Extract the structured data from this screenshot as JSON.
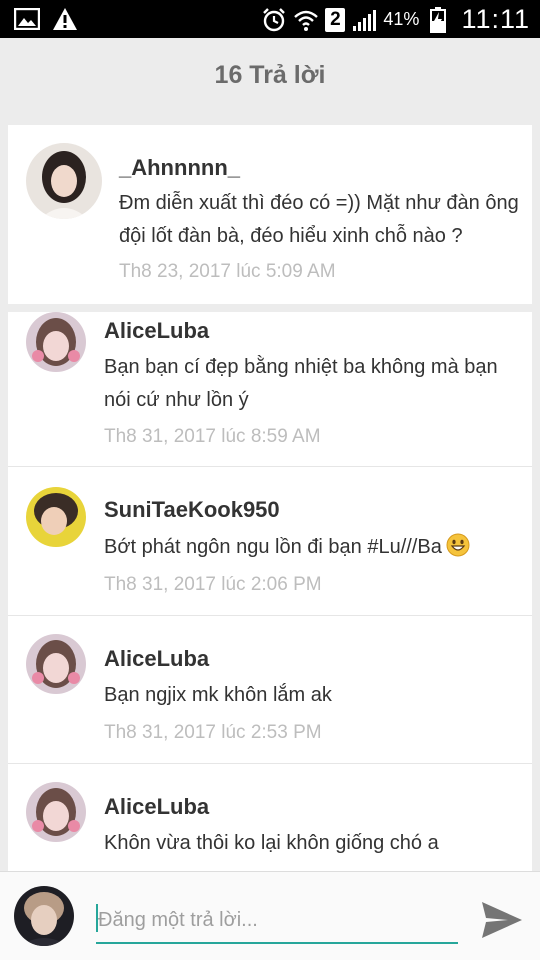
{
  "status_bar": {
    "sim_number": "2",
    "battery_percent": "41%",
    "time": "11:11"
  },
  "header": {
    "title": "16 Trả lời"
  },
  "main_comment": {
    "author": "_Ahnnnnn_",
    "text": "Đm diễn xuất thì đéo có =)) Mặt như đàn ông đội lốt đàn bà, đéo hiểu xinh chỗ nào ?",
    "timestamp": "Th8 23, 2017 lúc 5:09 AM"
  },
  "replies": [
    {
      "author": "AliceLuba",
      "text": "Bạn bạn cí đẹp bằng nhiệt ba không mà bạn nói cứ như lồn ý",
      "timestamp": "Th8 31, 2017 lúc 8:59 AM"
    },
    {
      "author": "SuniTaeKook950",
      "text": "Bớt phát ngôn ngu lồn đi bạn #Lu///Ba",
      "emoji": "grinning-face-emoji",
      "timestamp": "Th8 31, 2017 lúc 2:06 PM"
    },
    {
      "author": "AliceLuba",
      "text": "Bạn ngjix mk khôn lắm ak",
      "timestamp": "Th8 31, 2017 lúc 2:53 PM"
    },
    {
      "author": "AliceLuba",
      "text": "Khôn vừa thôi ko lại khôn giống chó a",
      "timestamp": ""
    }
  ],
  "composer": {
    "placeholder": "Đăng một trả lời...",
    "value": ""
  },
  "colors": {
    "accent": "#26a69a",
    "header_text": "#6b6b6b",
    "timestamp": "#bdbdbd",
    "background": "#ececec"
  }
}
